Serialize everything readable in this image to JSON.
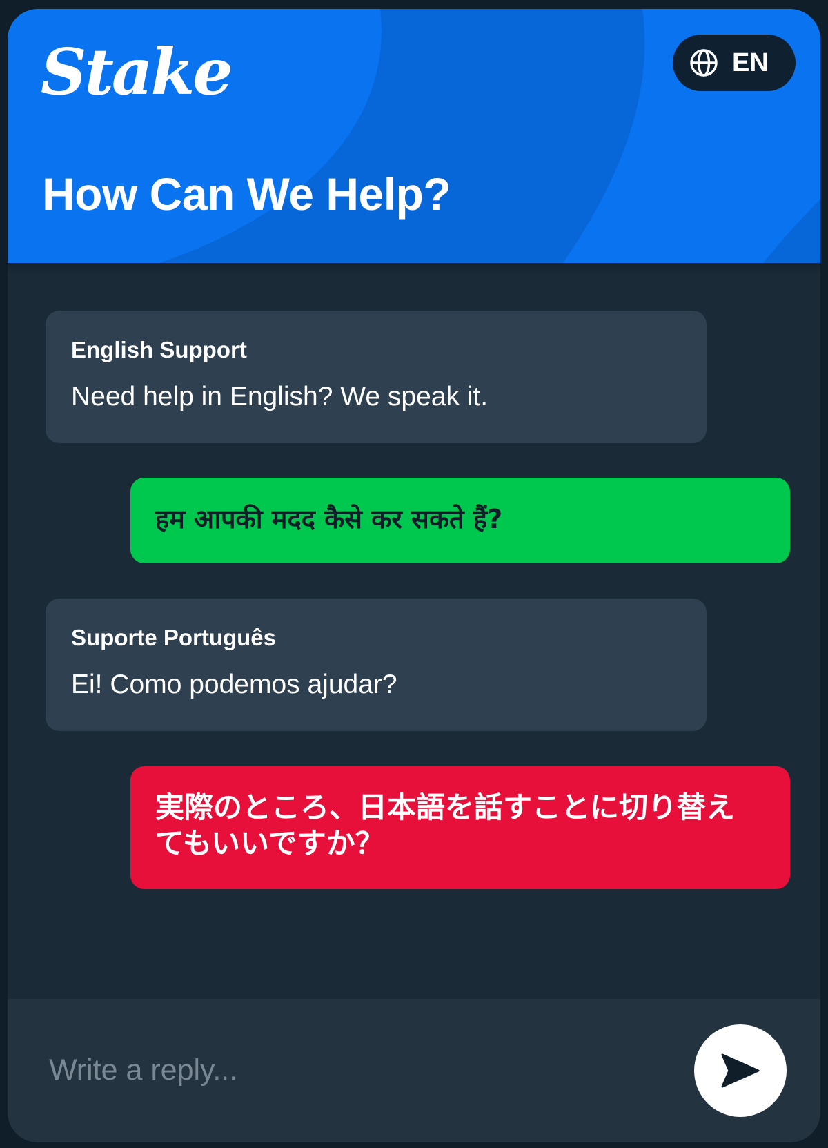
{
  "header": {
    "logo": "Stake",
    "language_code": "EN",
    "title": "How Can We Help?",
    "globe_icon": "globe-icon",
    "colors": {
      "background": "#0a74f0",
      "language_button": "#0f2131"
    }
  },
  "messages": [
    {
      "kind": "agent",
      "name": "English Support",
      "text": "Need help in English? We speak it."
    },
    {
      "kind": "user",
      "text": "हम आपकी मदद कैसे कर सकते हैं?",
      "color": "#00c74d"
    },
    {
      "kind": "agent",
      "name": "Suporte Português",
      "text": "Ei! Como podemos ajudar?"
    },
    {
      "kind": "user",
      "text": "実際のところ、日本語を話すことに切り替えてもいいですか？",
      "color": "#e6103b"
    }
  ],
  "composer": {
    "placeholder": "Write a reply...",
    "send_icon": "send-icon"
  },
  "colors": {
    "panel_background": "#1b2a37",
    "agent_bubble": "#2f4050",
    "composer_background": "#243340"
  }
}
